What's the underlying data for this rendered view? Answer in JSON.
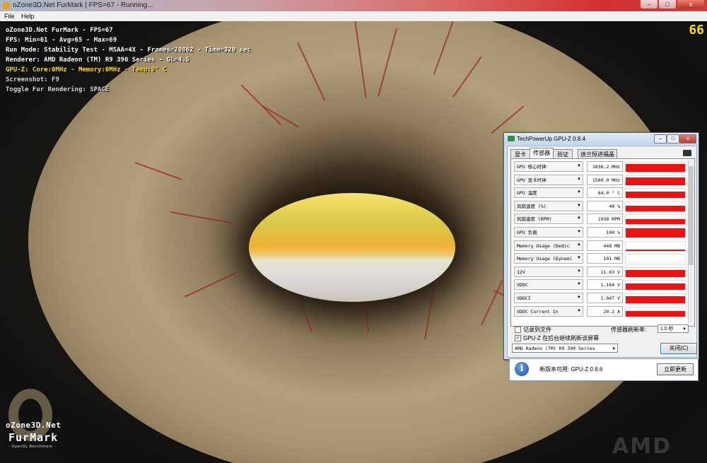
{
  "window": {
    "title": "oZone3D.Net FurMark | FPS=67 - Running...",
    "close_glyph": "x"
  },
  "menu": {
    "items": [
      "File",
      "Help"
    ]
  },
  "osd": {
    "lines": [
      {
        "text": "oZone3D.Net FurMark - FPS=67",
        "color": "#ffffff"
      },
      {
        "text": "FPS: Min=61 - Avg=65 - Max=69",
        "color": "#ffffff"
      },
      {
        "text": "Run Mode: Stability Test - MSAA=4X - Frames=20862 - Time=320 sec",
        "color": "#ffffff"
      },
      {
        "text": "Renderer: AMD Radeon (TM) R9 390 Series - GL=4.5",
        "color": "#ffffff"
      },
      {
        "text": "GPU-Z: Core:0MHz - Memory:0MHz - Temp:0° C",
        "color": "#ffe000"
      },
      {
        "text": "Screenshot: F9",
        "color": "#d8d8d8"
      },
      {
        "text": "Toggle Fur Rendering: SPACE",
        "color": "#d8d8d8"
      }
    ],
    "fps_corner": "66"
  },
  "logo": {
    "line1": "oZone3D.Net",
    "line2": "FurMark",
    "line3": "- OpenGL Benchmark -",
    "amd": "AMD"
  },
  "gpuz": {
    "title": "TechPowerUp GPU-Z 0.8.4",
    "tabs": [
      "显卡",
      "传感器",
      "验证",
      "迪兰恒进福晶"
    ],
    "active_tab": 1,
    "sensors": [
      {
        "label": "GPU 核心时钟",
        "value": "1036.2 MHz",
        "level": 0.85
      },
      {
        "label": "GPU 显卡时钟",
        "value": "1500.0 MHz",
        "level": 0.85
      },
      {
        "label": "GPU 温度",
        "value": "64.0 ° C",
        "level": 0.7
      },
      {
        "label": "风扇速度 (%)",
        "value": "40 %",
        "level": 0.6
      },
      {
        "label": "风扇速度 (RPM)",
        "value": "1938 RPM",
        "level": 0.6
      },
      {
        "label": "GPU 负载",
        "value": "100 %",
        "level": 1.0
      },
      {
        "label": "Memory Usage (Dedic",
        "value": "448 MB",
        "level": 0.12
      },
      {
        "label": "Memory Usage (Dynami",
        "value": "101 MB",
        "level": 0.05
      },
      {
        "label": "12V",
        "value": "11.63 V",
        "level": 0.75
      },
      {
        "label": "VDDC",
        "value": "1.164 V",
        "level": 0.75
      },
      {
        "label": "VDDCI",
        "value": "1.047 V",
        "level": 0.75
      },
      {
        "label": "VDDC Current In",
        "value": "20.2 A",
        "level": 0.55
      }
    ],
    "log_label": "记录到文件",
    "log_checked": false,
    "bg_label": "GPU-Z 在后台继续刷新该屏幕",
    "bg_checked": true,
    "refresh_label": "传感器刷新率:",
    "refresh_value": "1.0 秒",
    "gpu_name": "AMD Radeon (TM) R9 390 Series",
    "close_label": "关闭(C)",
    "graph_color": "#ee1111"
  },
  "update": {
    "message": "新版本可用: GPU-Z 0.8.6",
    "button": "立即更新"
  }
}
